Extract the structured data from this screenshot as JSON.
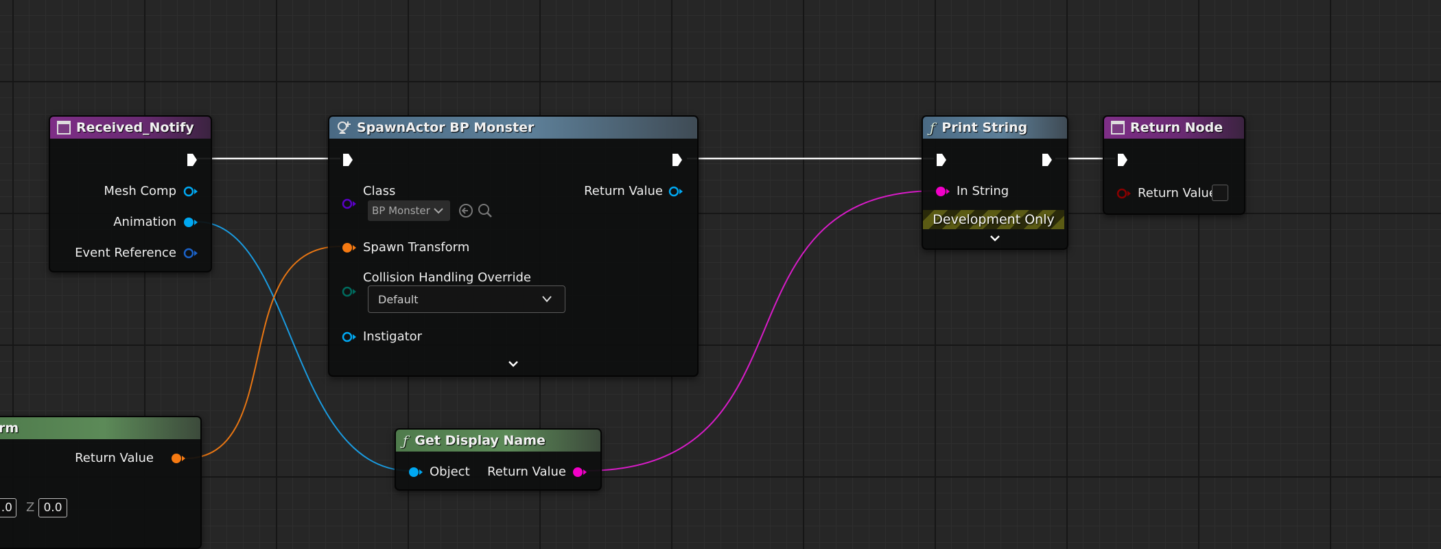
{
  "nodes": {
    "received_notify": {
      "title": "Received_Notify",
      "pins": {
        "mesh_comp": "Mesh Comp",
        "animation": "Animation",
        "event_reference": "Event Reference"
      }
    },
    "spawn_actor": {
      "title": "SpawnActor BP Monster",
      "class_label": "Class",
      "class_value": "BP Monster",
      "return_value": "Return Value",
      "spawn_transform": "Spawn Transform",
      "collision_label": "Collision Handling Override",
      "collision_value": "Default",
      "instigator": "Instigator"
    },
    "print_string": {
      "title": "Print String",
      "in_string": "In String",
      "dev_only": "Development Only"
    },
    "return_node": {
      "title": "Return Node",
      "return_value": "Return Value"
    },
    "get_display_name": {
      "title": "Get Display Name",
      "object": "Object",
      "return_value": "Return Value"
    },
    "transform": {
      "title_visible": "rm",
      "return_value": "Return Value",
      "x_partial": ".0",
      "z_label": "Z",
      "z_value": "0.0"
    }
  },
  "pin_colors": {
    "exec": "#ffffff",
    "object": "#00a8f2",
    "struct_transform": "#f67a12",
    "string": "#f200c8",
    "class": "#5a00c8",
    "enum": "#006b5e",
    "wildcard_red": "#8a0000"
  },
  "icons": {
    "event": "event-node-icon",
    "function": "function-f-icon",
    "spawn": "spawn-actor-icon"
  }
}
